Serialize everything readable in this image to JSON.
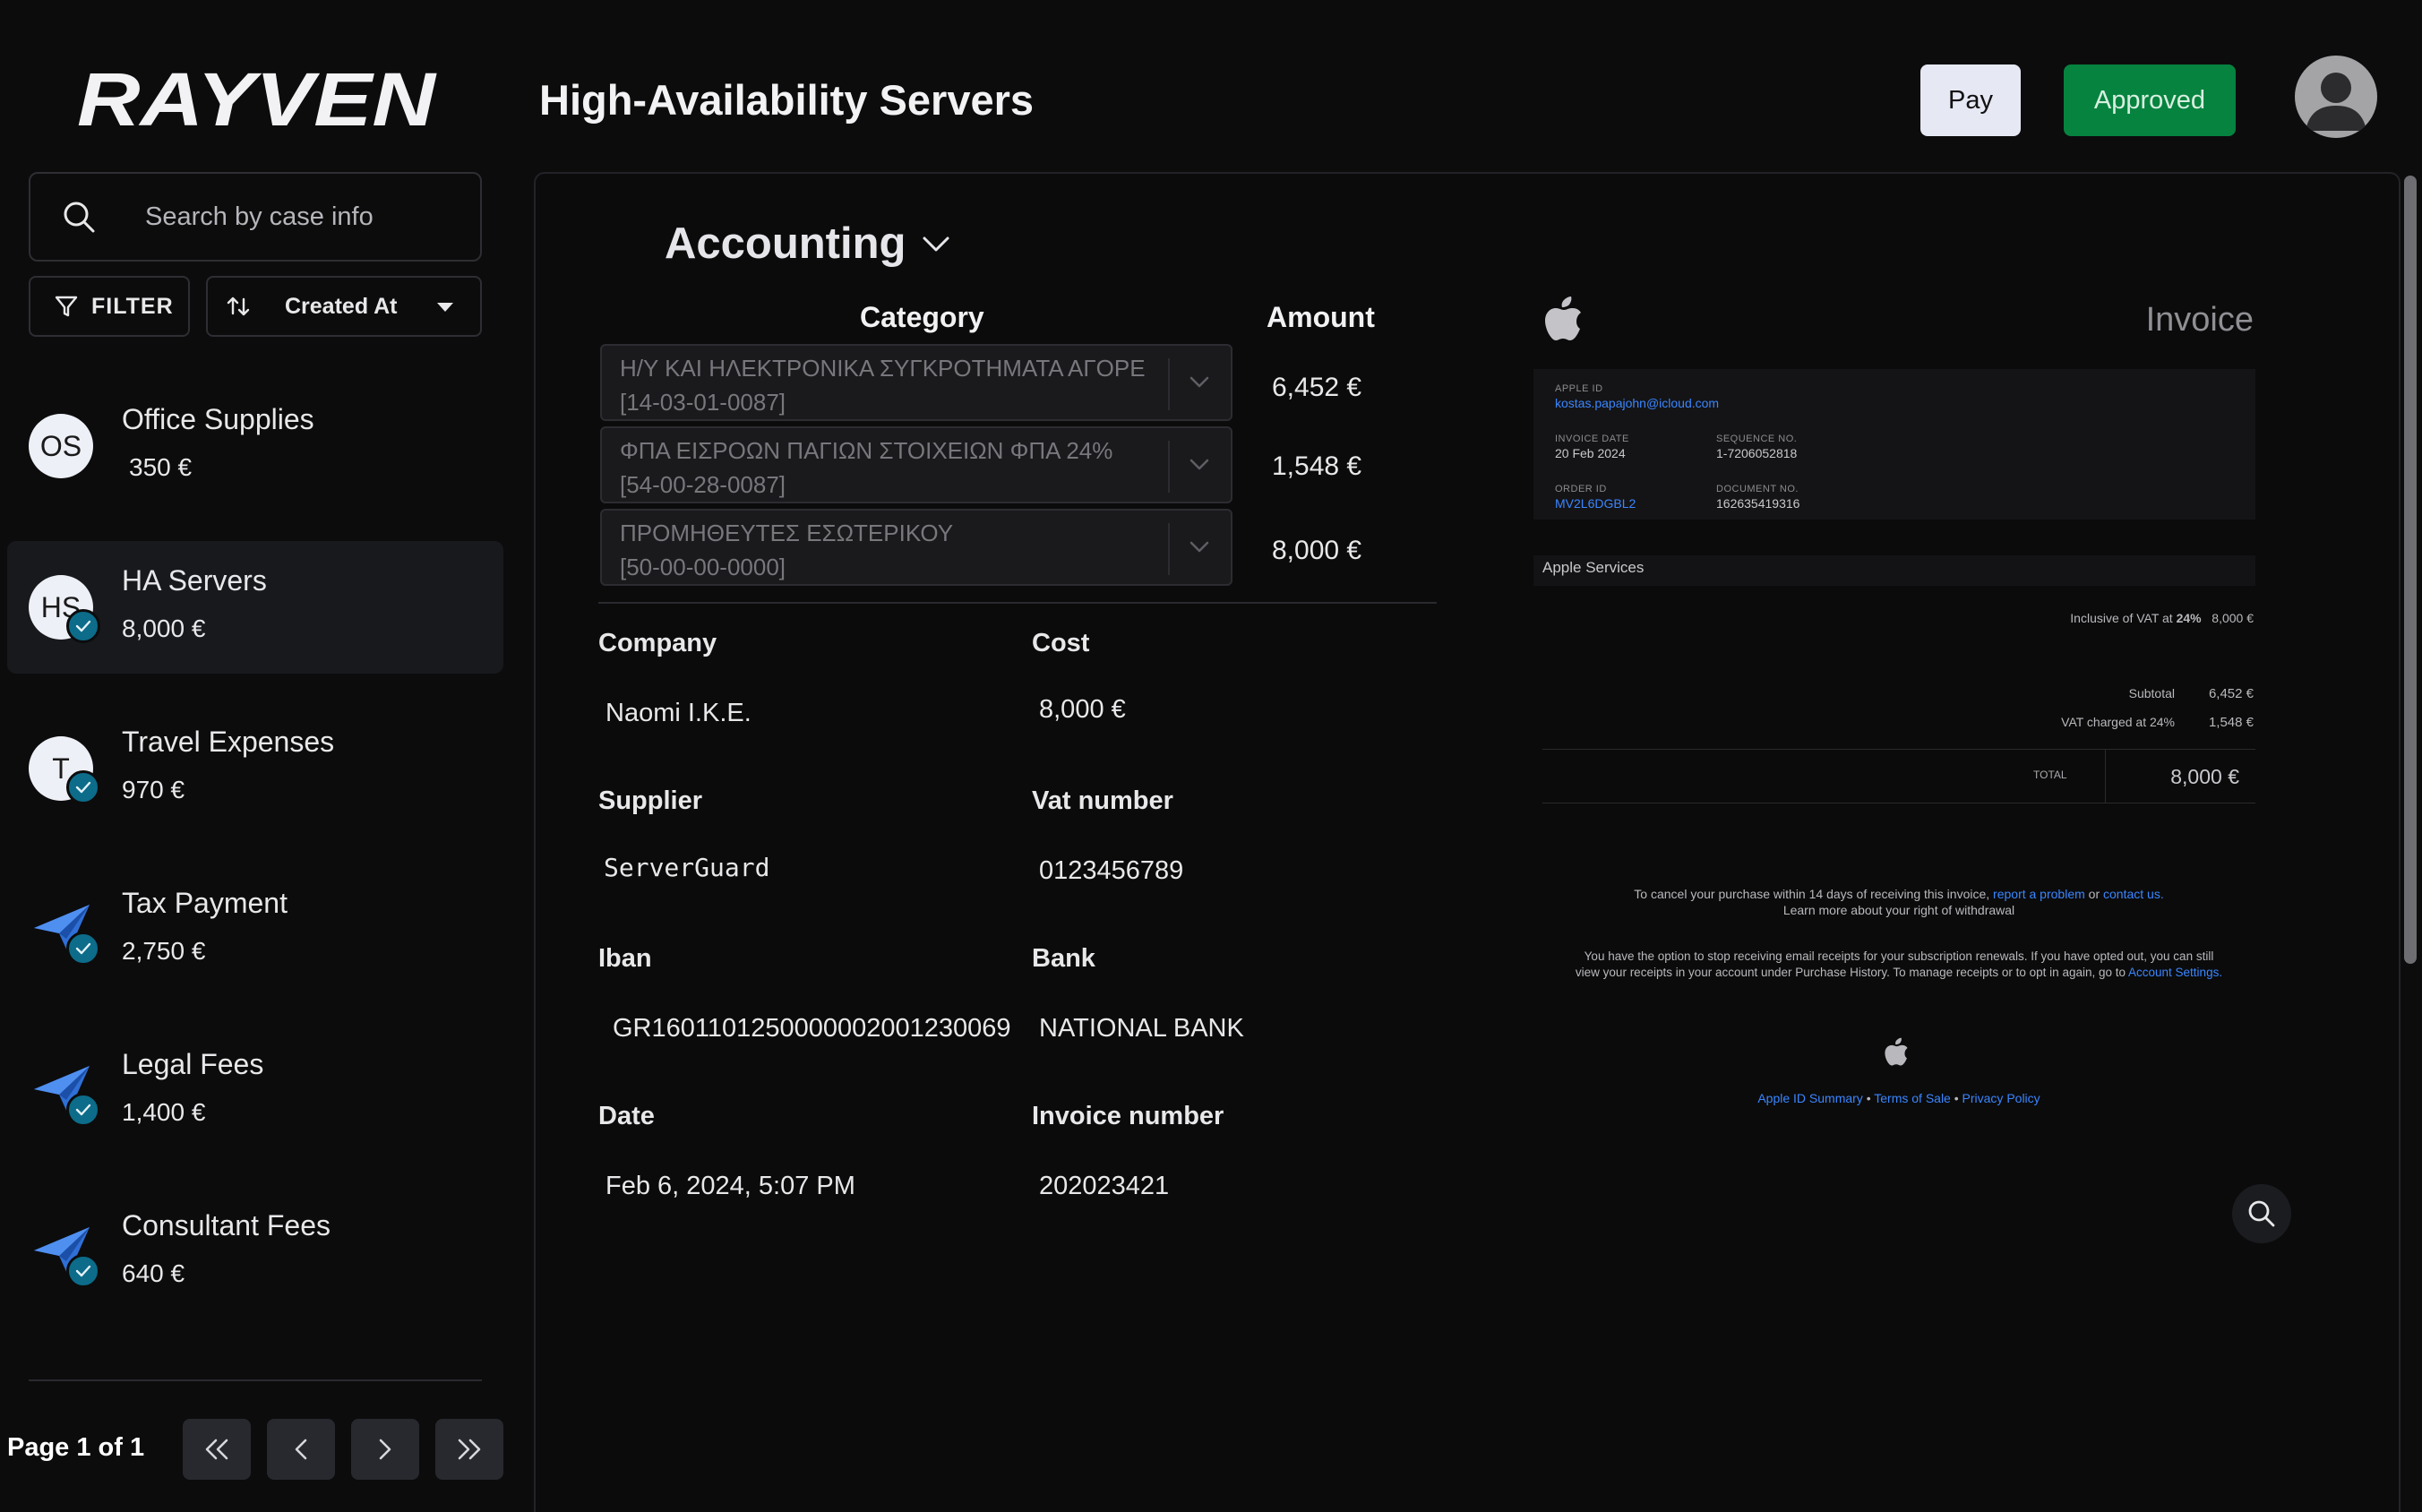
{
  "brand": {
    "logo_text": "RAYVEN"
  },
  "header": {
    "title": "High-Availability Servers",
    "pay_label": "Pay",
    "approved_label": "Approved",
    "colors": {
      "approved": "#06833f",
      "pay": "#e6e8f4"
    }
  },
  "sidebar": {
    "search_placeholder": "Search by case info",
    "filter_label": "FILTER",
    "sort_label": "Created At",
    "cases": [
      {
        "initials": "OS",
        "name": "Office Supplies",
        "amount": "350 €",
        "icon": "initials-avatar",
        "checked": false
      },
      {
        "initials": "HS",
        "name": "HA Servers",
        "amount": "8,000 €",
        "icon": "initials-avatar",
        "checked": true,
        "active": true
      },
      {
        "initials": "T",
        "name": "Travel Expenses",
        "amount": "970 €",
        "icon": "initials-avatar",
        "checked": true
      },
      {
        "initials": "",
        "name": "Tax Payment",
        "amount": "2,750 €",
        "icon": "paper-plane-icon",
        "checked": true
      },
      {
        "initials": "",
        "name": "Legal Fees",
        "amount": "1,400 €",
        "icon": "paper-plane-icon",
        "checked": true
      },
      {
        "initials": "",
        "name": "Consultant Fees",
        "amount": "640 €",
        "icon": "paper-plane-icon",
        "checked": true
      }
    ],
    "page_label": "Page 1 of 1"
  },
  "main": {
    "section_title": "Accounting",
    "category_header": "Category",
    "amount_header": "Amount",
    "categories": [
      {
        "line1": "Η/Υ ΚΑΙ ΗΛΕΚΤΡΟΝΙΚΑ ΣΥΓΚΡΟΤΗΜΑΤΑ ΑΓΟΡΕ",
        "line2": "[14-03-01-0087]",
        "amount": "6,452 €"
      },
      {
        "line1": "ΦΠΑ ΕΙΣΡΟΩΝ ΠΑΓΙΩΝ ΣΤΟΙΧΕΙΩΝ ΦΠΑ 24%",
        "line2": "[54-00-28-0087]",
        "amount": "1,548 €"
      },
      {
        "line1": "ΠΡΟΜΗΘΕΥΤΕΣ ΕΣΩΤΕΡΙΚΟΥ",
        "line2": "[50-00-00-0000]",
        "amount": "8,000 €"
      }
    ],
    "fields": {
      "company_label": "Company",
      "company_value": "Naomi I.K.E.",
      "cost_label": "Cost",
      "cost_value": "8,000 €",
      "supplier_label": "Supplier",
      "supplier_value": "ServerGuard",
      "vat_label": "Vat number",
      "vat_value": "0123456789",
      "iban_label": "Iban",
      "iban_value": "GR1601101250000002001230069",
      "bank_label": "Bank",
      "bank_value": "NATIONAL BANK",
      "date_label": "Date",
      "date_value": "Feb 6, 2024, 5:07 PM",
      "invoice_label": "Invoice number",
      "invoice_value": "202023421"
    }
  },
  "invoice_preview": {
    "title": "Invoice",
    "apple_id_label": "APPLE ID",
    "apple_id_value": "kostas.papajohn@icloud.com",
    "invoice_date_label": "INVOICE DATE",
    "invoice_date_value": "20 Feb 2024",
    "sequence_label": "SEQUENCE NO.",
    "sequence_value": "1-7206052818",
    "order_id_label": "ORDER ID",
    "order_id_value": "MV2L6DGBL2",
    "document_label": "DOCUMENT NO.",
    "document_value": "162635419316",
    "services_label": "Apple Services",
    "vat_inclusive_prefix": "Inclusive of VAT at ",
    "vat_inclusive_rate": "24%",
    "vat_inclusive_amount": "8,000 €",
    "subtotal_label": "Subtotal",
    "subtotal_value": "6,452 €",
    "vat_charged_label": "VAT charged at 24%",
    "vat_charged_value": "1,548 €",
    "total_label": "TOTAL",
    "total_value": "8,000 €",
    "cancel_text_a": "To cancel your purchase within 14 days of receiving this invoice, ",
    "cancel_link_1": "report a problem",
    "cancel_text_b": " or ",
    "cancel_link_2": "contact us.",
    "withdrawal_link": "Learn more about your right of withdrawal",
    "receipts_text_1": "You have the option to stop receiving email receipts for your subscription renewals. If you have opted out, you can still",
    "receipts_text_2": "view your receipts in your account under Purchase History. To manage receipts or to opt in again, go to ",
    "account_settings_link": "Account Settings.",
    "footer_link_1": "Apple ID Summary",
    "footer_sep": " • ",
    "footer_link_2": "Terms of Sale",
    "footer_link_3": "Privacy Policy"
  }
}
